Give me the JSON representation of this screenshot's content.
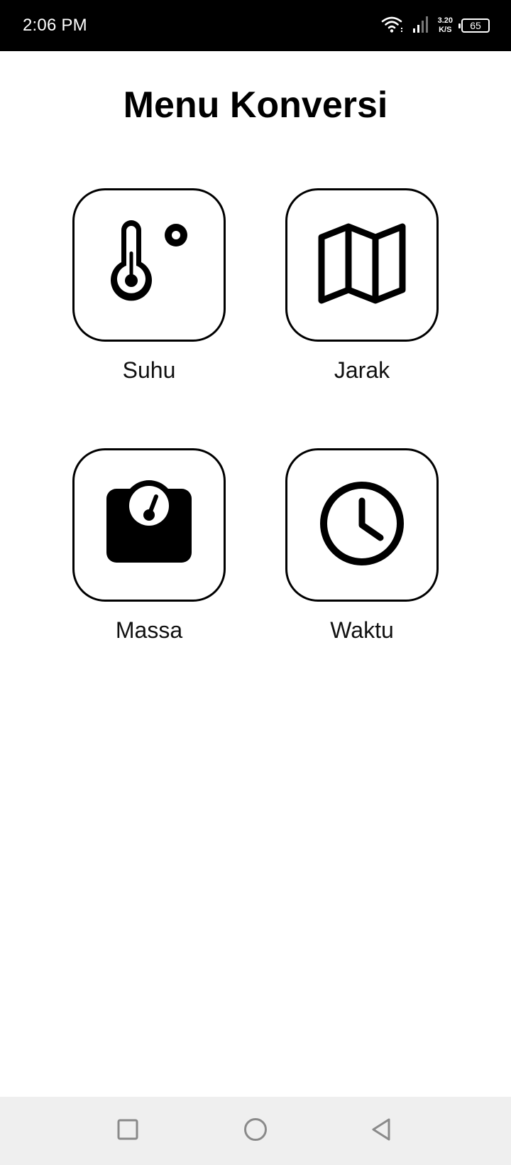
{
  "status_bar": {
    "time": "2:06 PM",
    "net_speed_value": "3.20",
    "net_speed_unit": "K/S",
    "battery_level": "65",
    "icons": [
      "wifi-icon",
      "signal-icon",
      "battery-icon"
    ]
  },
  "page": {
    "title": "Menu Konversi"
  },
  "menu": {
    "items": [
      {
        "label": "Suhu",
        "icon": "thermometer-icon"
      },
      {
        "label": "Jarak",
        "icon": "map-icon"
      },
      {
        "label": "Massa",
        "icon": "scale-icon"
      },
      {
        "label": "Waktu",
        "icon": "clock-icon"
      }
    ]
  },
  "nav_bar": {
    "buttons": [
      "recent-apps-button",
      "home-button",
      "back-button"
    ]
  },
  "colors": {
    "status_bar_bg": "#000000",
    "page_bg": "#ffffff",
    "tile_border": "#000000",
    "nav_bar_bg": "#efefef",
    "nav_icon": "#8a8a8a"
  }
}
